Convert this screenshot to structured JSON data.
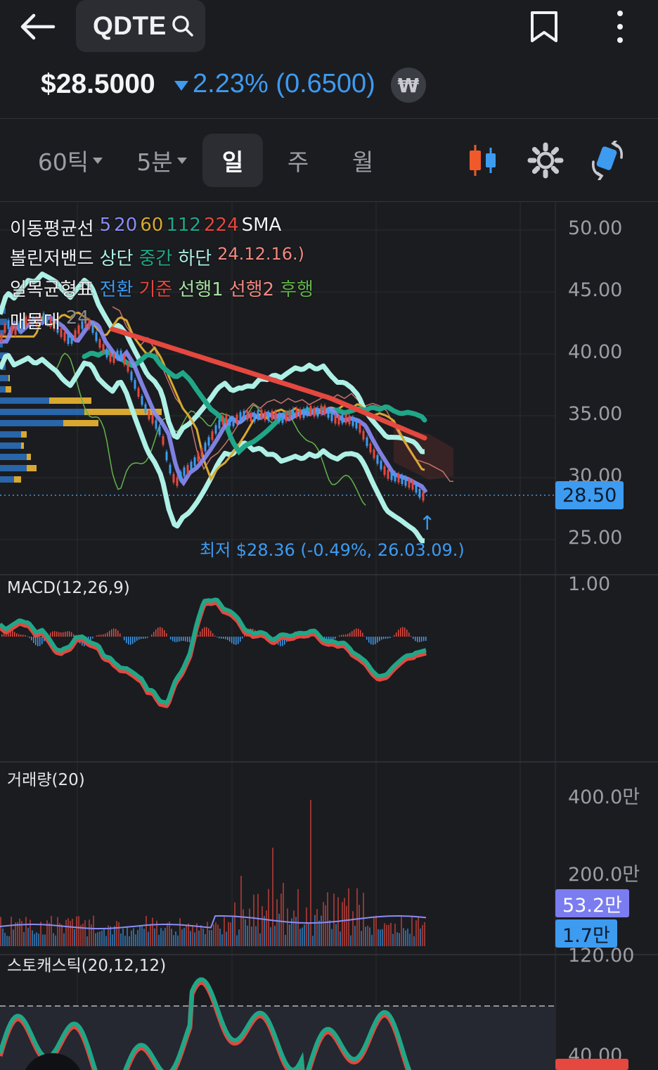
{
  "header": {
    "ticker": "QDTE",
    "price": "$28.5000",
    "change": "2.23% (0.6500)",
    "currency_symbol": "₩"
  },
  "tabs": [
    {
      "label": "60틱",
      "dropdown": true
    },
    {
      "label": "5분",
      "dropdown": true
    },
    {
      "label": "일",
      "active": true
    },
    {
      "label": "주"
    },
    {
      "label": "월"
    }
  ],
  "legend": {
    "ma": {
      "title": "이동평균선",
      "periods": [
        "5",
        "20",
        "60",
        "112",
        "224"
      ],
      "suffix": "SMA"
    },
    "bollinger": {
      "title": "볼린저밴드",
      "items": [
        "상단",
        "중간",
        "하단"
      ],
      "note": "24.12.16.)"
    },
    "ichimoku": {
      "title": "일목균형표",
      "items": [
        "전환",
        "기준",
        "선행1",
        "선행2",
        "후행"
      ]
    },
    "volume_profile": {
      "title": "매물대",
      "value": "24"
    }
  },
  "price_axis": [
    "50.00",
    "45.00",
    "40.00",
    "35.00",
    "30.00",
    "25.00"
  ],
  "current_price_tag": "28.50",
  "low_note": "최저 $28.36 (-0.49%, 26.03.09.)",
  "low_arrow": "↑",
  "macd": {
    "title": "MACD(12,26,9)",
    "axis": [
      "1.00"
    ]
  },
  "volume": {
    "title": "거래량(20)",
    "axis": [
      "400.0만",
      "200.0만",
      "120.00"
    ],
    "tag_ma": "53.2만",
    "tag_vol": "1.7만"
  },
  "stochastic": {
    "title": "스토캐스틱(20,12,12)",
    "axis": [
      "40.00"
    ]
  },
  "colors": {
    "background": "#1b1c20",
    "up": "#e4483f",
    "down": "#3d9bf0",
    "ma5": "#8b8cf5",
    "ma20": "#d8a830",
    "ma60": "#20a787",
    "ma112": "#e4483f",
    "bollinger": "#aef0e6",
    "ichimoku_lagging": "#62b44a"
  },
  "chart_data": [
    {
      "type": "line",
      "name": "price",
      "x": [
        0,
        10,
        20,
        30,
        40,
        50,
        60,
        70,
        80,
        90,
        100,
        110,
        120,
        130,
        140,
        150,
        160,
        170,
        180,
        190,
        200,
        210,
        220,
        230,
        240,
        250,
        260,
        270,
        280,
        290,
        300,
        310,
        320,
        330,
        340,
        350,
        360,
        370,
        380,
        390,
        400,
        410,
        420,
        430,
        440,
        450,
        460,
        470,
        480,
        490,
        500,
        510,
        520,
        530,
        540,
        550,
        560,
        570,
        580,
        590,
        600
      ],
      "y": [
        41,
        42.5,
        41.8,
        42.3,
        42.8,
        42.5,
        43,
        42.6,
        42.2,
        41.5,
        41,
        41.8,
        42.6,
        42.3,
        41,
        40.2,
        39.5,
        40.1,
        39.2,
        37.8,
        36.5,
        35.2,
        34.5,
        33.5,
        31,
        29.5,
        30.4,
        30.8,
        31.5,
        32.3,
        33.2,
        34.2,
        34.8,
        34.4,
        34.9,
        35.1,
        34.8,
        35.2,
        34.9,
        35.1,
        34.7,
        35,
        35.3,
        35.1,
        35.5,
        35.2,
        35.6,
        35,
        34.6,
        34.8,
        34.6,
        34.2,
        33.1,
        32.1,
        31.2,
        30.3,
        30.1,
        29.9,
        29.6,
        29.3,
        28.5
      ],
      "ylim": [
        25,
        50
      ]
    },
    {
      "type": "line",
      "name": "MACD",
      "ylim": [
        -2,
        1
      ]
    },
    {
      "type": "bar",
      "name": "거래량",
      "ylim": [
        0,
        4000000
      ]
    },
    {
      "type": "line",
      "name": "스토캐스틱",
      "ylim": [
        0,
        100
      ]
    }
  ]
}
